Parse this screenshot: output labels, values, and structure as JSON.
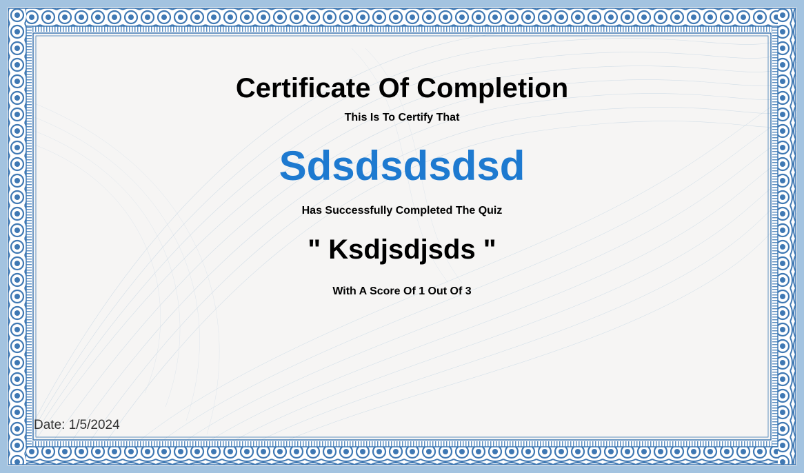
{
  "certificate": {
    "title": "Certificate Of Completion",
    "certify_line": "This Is To Certify That",
    "recipient_name": "Sdsdsdsdsd",
    "completed_line": "Has Successfully Completed The Quiz",
    "quiz_name": "\" Ksdjsdjsds \"",
    "score_line": "With A Score Of 1 Out Of 3",
    "date_text": "Date: 1/5/2024"
  },
  "colors": {
    "page_background": "#a3c3e0",
    "paper": "#f6f5f4",
    "border_blue": "#3f78b3",
    "recipient_blue": "#1e7ad0"
  }
}
